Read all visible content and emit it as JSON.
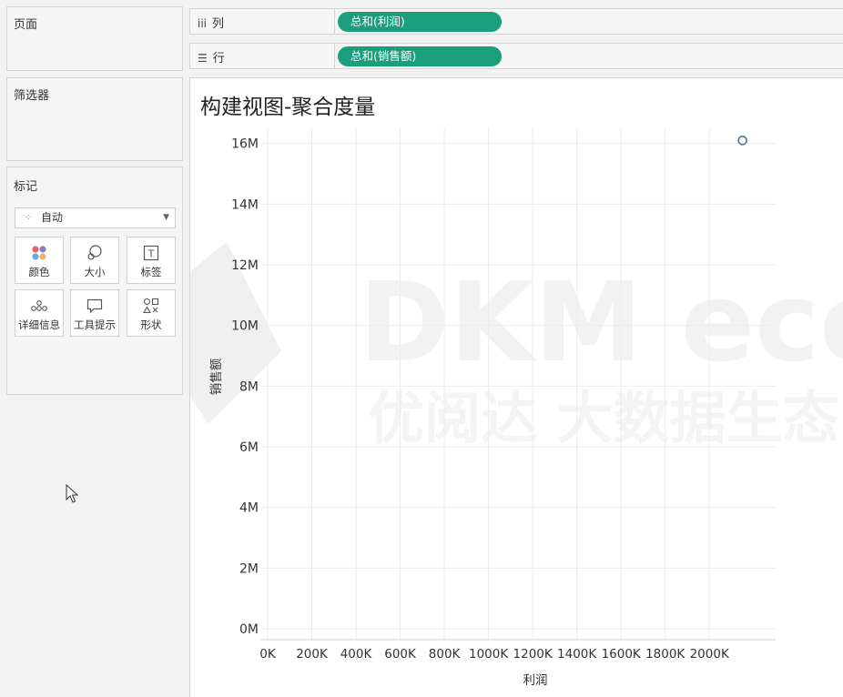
{
  "left_panel": {
    "pages_title": "页面",
    "filters_title": "筛选器",
    "marks": {
      "title": "标记",
      "mark_type": "自动",
      "buttons": [
        {
          "label": "颜色",
          "icon": "color-icon"
        },
        {
          "label": "大小",
          "icon": "size-icon"
        },
        {
          "label": "标签",
          "icon": "label-icon"
        },
        {
          "label": "详细信息",
          "icon": "detail-icon"
        },
        {
          "label": "工具提示",
          "icon": "tooltip-icon"
        },
        {
          "label": "形状",
          "icon": "shape-icon"
        }
      ]
    }
  },
  "shelves": {
    "columns": {
      "label": "列",
      "icon": "columns-icon",
      "pill": "总和(利润)"
    },
    "rows": {
      "label": "行",
      "icon": "rows-icon",
      "pill": "总和(销售额)"
    }
  },
  "view": {
    "title": "构建视图-聚合度量"
  },
  "watermark": {
    "line1": "DKM ecc",
    "line2": "优阅达 大数据生态"
  },
  "colors": {
    "pill": "#1a9e7b",
    "mark": "#5b6f8c",
    "grid": "#ececec"
  },
  "chart_data": {
    "type": "scatter",
    "title": "构建视图-聚合度量",
    "xlabel": "利润",
    "ylabel": "销售额",
    "x_ticks": [
      "0K",
      "200K",
      "400K",
      "600K",
      "800K",
      "1000K",
      "1200K",
      "1400K",
      "1600K",
      "1800K",
      "2000K"
    ],
    "y_ticks": [
      "0M",
      "2M",
      "4M",
      "6M",
      "8M",
      "10M",
      "12M",
      "14M",
      "16M"
    ],
    "xlim": [
      0,
      2300000
    ],
    "ylim": [
      0,
      16500000
    ],
    "points": [
      {
        "x": 2150000,
        "y": 16100000
      }
    ],
    "grid": true,
    "marker": "open-circle"
  }
}
